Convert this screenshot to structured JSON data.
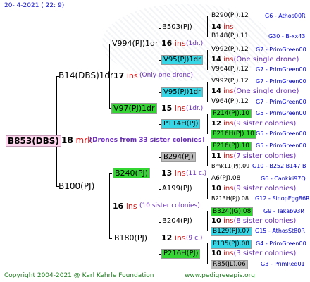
{
  "header": {
    "date_text": "20-  4-2021 ( 22:  9)"
  },
  "footer": {
    "copyright": "Copyright 2004-2021 @ Karl Kehrle Foundation",
    "site": "www.pedigreeapis.org"
  },
  "root": {
    "code": "B853(DBS)",
    "count": "18",
    "unit": "mrk",
    "note": "[Drones from 33 sister colonies]"
  },
  "gen1": [
    {
      "code": "B14(DBS)1dr",
      "count": "17",
      "unit": "ins",
      "note": "(Only one drone)"
    },
    {
      "code": "B100(PJ)",
      "count": "16",
      "unit": "ins",
      "note": "(10 sister colonies)"
    }
  ],
  "gen2": [
    {
      "code": "V994(PJ)1dr",
      "count": "16",
      "unit": "ins",
      "note": "(1dr.)"
    },
    {
      "code": "V97(PJ)1dr",
      "count": "15",
      "unit": "ins",
      "note": "(1dr.)"
    },
    {
      "code": "B240(PJ)",
      "count": "13",
      "unit": "ins",
      "note": "(11 c.)"
    },
    {
      "code": "B180(PJ)",
      "count": "12",
      "unit": "ins",
      "note": "(9 c.)"
    }
  ],
  "gen3": [
    {
      "code": "B503(PJ)",
      "count": "14",
      "unit": "ins",
      "note": ""
    },
    {
      "code": "V95(PJ)1dr",
      "count": "14",
      "unit": "ins",
      "note": "(One single drone)"
    },
    {
      "code": "V95(PJ)1dr",
      "count": "14",
      "unit": "ins",
      "note": "(One single drone)"
    },
    {
      "code": "P114H(PJ)",
      "count": "12",
      "unit": "ins",
      "note": "(9 sister colonies)"
    },
    {
      "code": "B294(PJ)",
      "count": "11",
      "unit": "ins",
      "note": "(7 sister colonies)"
    },
    {
      "code": "A199(PJ)",
      "count": "10",
      "unit": "ins",
      "note": "(9 sister colonies)"
    },
    {
      "code": "B204(PJ)",
      "count": "10",
      "unit": "ins",
      "note": "(8 sister colonies)"
    },
    {
      "code": "P216H(PJ)",
      "count": "10",
      "unit": "ins",
      "note": "(3 sister colonies)"
    }
  ],
  "gen4": [
    {
      "code": "B290(PJ).12",
      "info": "G6 - Athos00R"
    },
    {
      "code": "B148(PJ).11",
      "info": "G30 - B-xx43"
    },
    {
      "code": "V992(PJ).12",
      "info": "G7 - PrimGreen00"
    },
    {
      "code": "V964(PJ).12",
      "info": "G7 - PrimGreen00"
    },
    {
      "code": "V992(PJ).12",
      "info": "G7 - PrimGreen00"
    },
    {
      "code": "V964(PJ).12",
      "info": "G7 - PrimGreen00"
    },
    {
      "code": "P214(PJ).10",
      "info": "G5 - PrimGreen00"
    },
    {
      "code": "P216H(PJ).10",
      "info": "G5 - PrimGreen00"
    },
    {
      "code": "P216(PJ).10",
      "info": "G5 - PrimGreen00"
    },
    {
      "code": "Bmk11(PJ).09",
      "info": "G10 - B252 B147 B"
    },
    {
      "code": "A6(PJ).08",
      "info": "G6 - Cankiri97Q"
    },
    {
      "code": "B213H(PJ).08",
      "info": "G12 - SinopEgg86R"
    },
    {
      "code": "B324(JG).08",
      "info": "G9 - Takab93R"
    },
    {
      "code": "B129(PJ).07",
      "info": "G15 - AthosSt80R"
    },
    {
      "code": "P135(PJ).08",
      "info": "G4 - PrimGreen00"
    },
    {
      "code": "R85(JL).06",
      "info": "G3 - PrimRed01"
    }
  ]
}
